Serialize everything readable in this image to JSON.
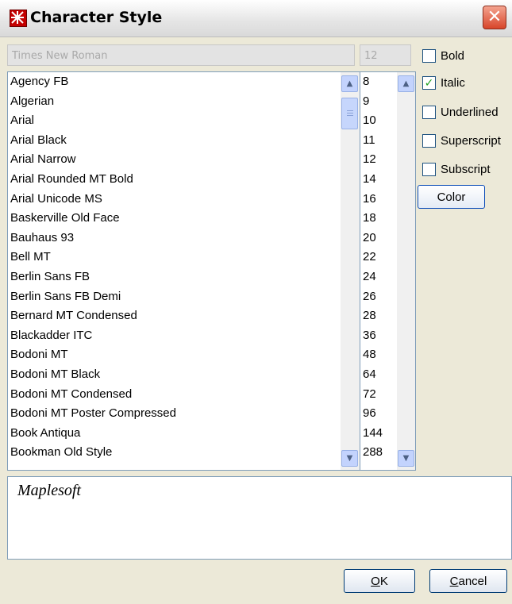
{
  "window": {
    "title": "Character Style"
  },
  "font_field": {
    "value": "Times New Roman"
  },
  "size_field": {
    "value": "12"
  },
  "fonts": [
    "Agency FB",
    "Algerian",
    "Arial",
    "Arial Black",
    "Arial Narrow",
    "Arial Rounded MT Bold",
    "Arial Unicode MS",
    "Baskerville Old Face",
    "Bauhaus 93",
    "Bell MT",
    "Berlin Sans FB",
    "Berlin Sans FB Demi",
    "Bernard MT Condensed",
    "Blackadder ITC",
    "Bodoni MT",
    "Bodoni MT Black",
    "Bodoni MT Condensed",
    "Bodoni MT Poster Compressed",
    "Book Antiqua",
    "Bookman Old Style"
  ],
  "sizes": [
    "8",
    "9",
    "10",
    "11",
    "12",
    "14",
    "16",
    "18",
    "20",
    "22",
    "24",
    "26",
    "28",
    "36",
    "48",
    "64",
    "72",
    "96",
    "144",
    "288"
  ],
  "options": [
    {
      "label": "Bold",
      "checked": false
    },
    {
      "label": "Italic",
      "checked": true
    },
    {
      "label": "Underlined",
      "checked": false
    },
    {
      "label": "Superscript",
      "checked": false
    },
    {
      "label": "Subscript",
      "checked": false
    }
  ],
  "color_button": {
    "label": "Color"
  },
  "preview": {
    "text": "Maplesoft"
  },
  "buttons": {
    "ok_label": "OK",
    "ok_mnemonic": "O",
    "ok_rest": "K",
    "cancel_label": "Cancel",
    "cancel_mnemonic": "C",
    "cancel_rest": "ancel"
  },
  "icons": {
    "close": "close-icon",
    "app": "app-icon",
    "scroll_up": "chevron-up-icon",
    "scroll_down": "chevron-down-icon",
    "check": "check-icon"
  }
}
